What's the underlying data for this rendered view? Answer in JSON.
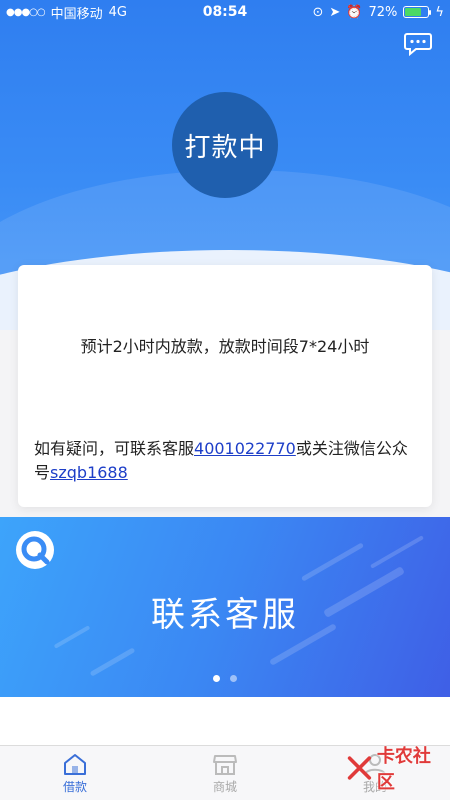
{
  "status_bar": {
    "carrier": "中国移动",
    "network": "4G",
    "time": "08:54",
    "battery": "72%",
    "battery_level": 0.72
  },
  "status": {
    "label": "打款中"
  },
  "card": {
    "eta_text": "预计2小时内放款，放款时间段7*24小时",
    "contact_prefix": "如有疑问，可联系客服",
    "phone": "4001022770",
    "contact_middle": "或关注微信公众号",
    "wechat": "szqb1688"
  },
  "banner": {
    "title": "联系客服",
    "slides": 2,
    "active_slide": 0
  },
  "tabbar": {
    "tabs": [
      {
        "label": "借款",
        "icon": "home-icon",
        "active": true
      },
      {
        "label": "商城",
        "icon": "shop-icon",
        "active": false
      },
      {
        "label": "我的",
        "icon": "user-icon",
        "active": false
      }
    ]
  },
  "watermark": {
    "text": "卡农社区"
  },
  "colors": {
    "primary": "#2f7ef0",
    "status_circle": "#1f5fae",
    "link": "#1d3ec8",
    "tab_active": "#3a6fd8"
  }
}
